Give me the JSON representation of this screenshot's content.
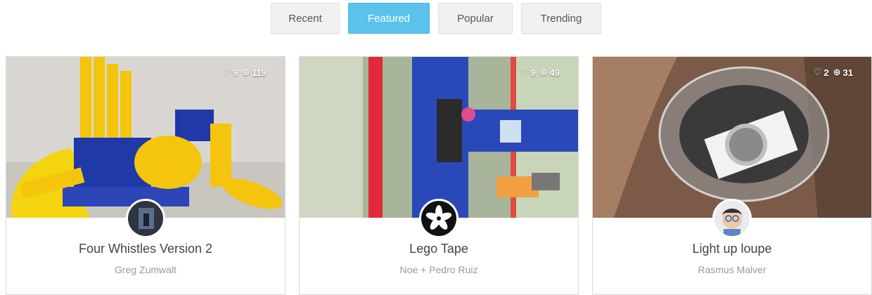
{
  "tabs": [
    "Recent",
    "Featured",
    "Popular",
    "Trending"
  ],
  "active_tab": "Featured",
  "colors": {
    "active_tab": "#5bc2ec"
  },
  "cards": [
    {
      "title": "Four Whistles Version 2",
      "author": "Greg Zumwalt",
      "likes": "9",
      "downloads": "119"
    },
    {
      "title": "Lego Tape",
      "author": "Noe + Pedro Ruiz",
      "likes": "9",
      "downloads": "49"
    },
    {
      "title": "Light up loupe",
      "author": "Rasmus Malver",
      "likes": "2",
      "downloads": "31"
    }
  ]
}
